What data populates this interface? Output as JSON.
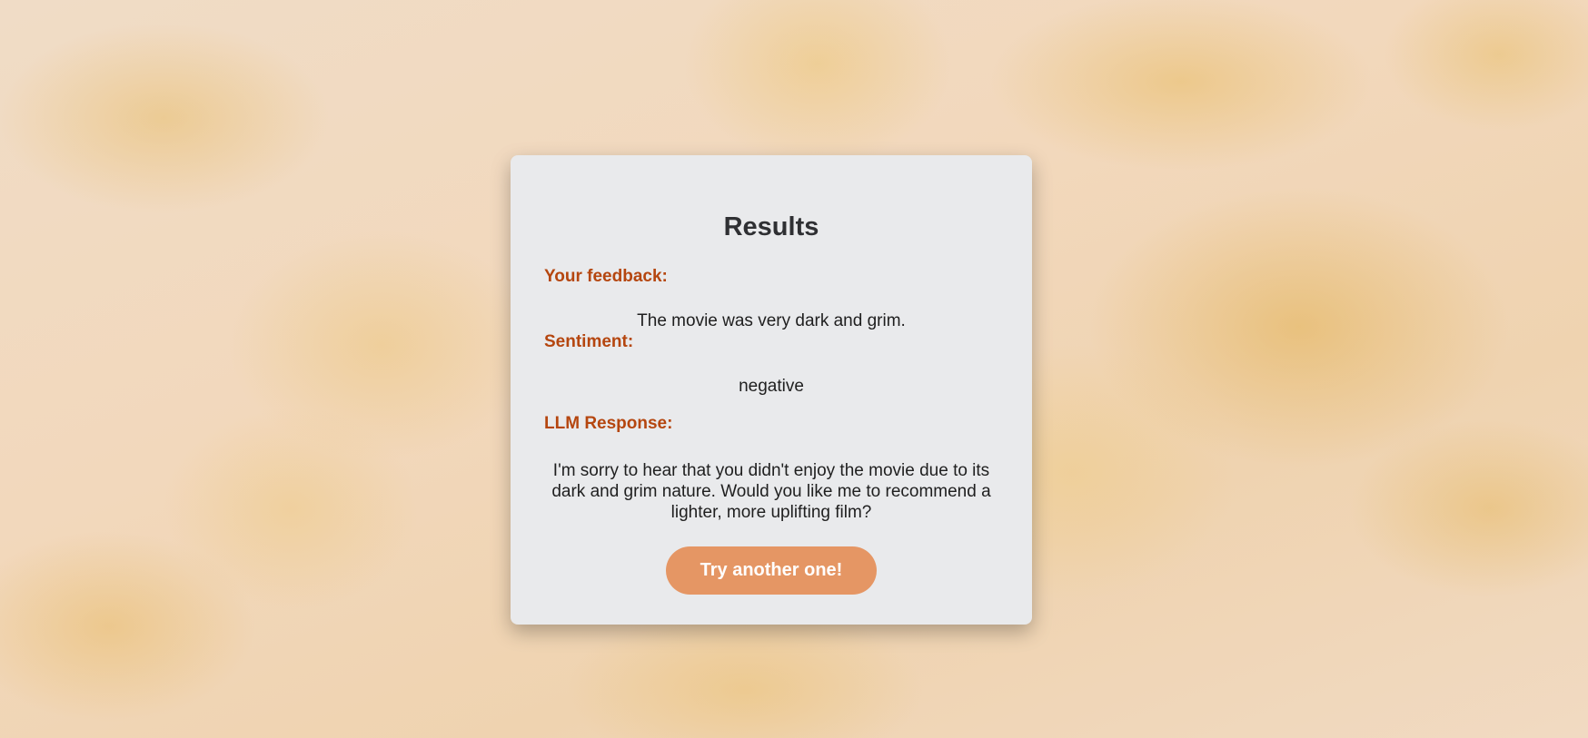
{
  "results": {
    "title": "Results",
    "feedback_label": "Your feedback:",
    "feedback_text": "The movie was very dark and grim.",
    "sentiment_label": "Sentiment:",
    "sentiment_value": "negative",
    "llm_label": "LLM Response:",
    "llm_response": "I'm sorry to hear that you didn't enjoy the movie due to its dark and grim nature. Would you like me to recommend a lighter, more uplifting film?",
    "button_label": "Try another one!"
  },
  "colors": {
    "label": "#b5460f",
    "button": "#e59664",
    "card": "#e9eaec"
  }
}
